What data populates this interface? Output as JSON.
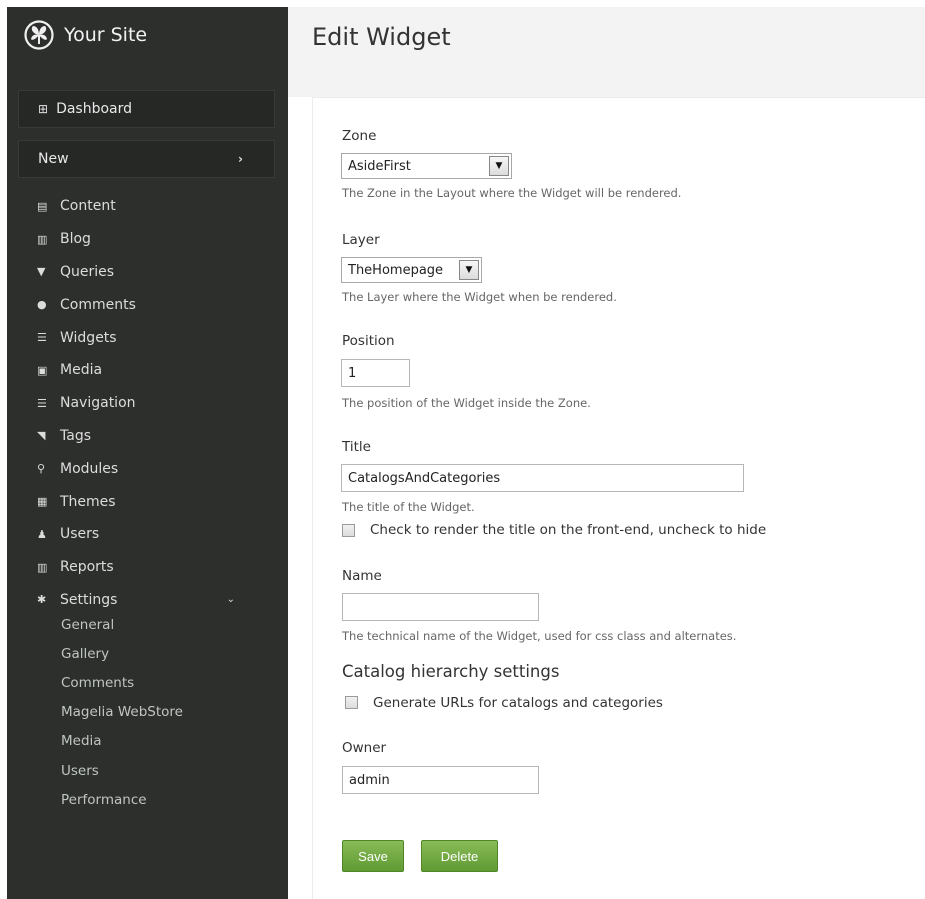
{
  "brand": {
    "name": "Your Site",
    "logo_icon": "orchard-logo-icon"
  },
  "sidebar": {
    "dashboard": {
      "label": "Dashboard",
      "icon": "dashboard-icon"
    },
    "new": {
      "label": "New",
      "icon": "chevron-right-icon"
    },
    "items": [
      {
        "label": "Content",
        "icon": "content-icon"
      },
      {
        "label": "Blog",
        "icon": "blog-icon"
      },
      {
        "label": "Queries",
        "icon": "filter-icon"
      },
      {
        "label": "Comments",
        "icon": "comment-icon"
      },
      {
        "label": "Widgets",
        "icon": "widgets-icon"
      },
      {
        "label": "Media",
        "icon": "media-icon"
      },
      {
        "label": "Navigation",
        "icon": "navigation-icon"
      },
      {
        "label": "Tags",
        "icon": "tag-icon"
      },
      {
        "label": "Modules",
        "icon": "modules-icon"
      },
      {
        "label": "Themes",
        "icon": "themes-icon"
      },
      {
        "label": "Users",
        "icon": "user-icon"
      },
      {
        "label": "Reports",
        "icon": "reports-icon"
      },
      {
        "label": "Settings",
        "icon": "gear-icon"
      }
    ],
    "settings_sub": [
      "General",
      "Gallery",
      "Comments",
      "Magelia WebStore",
      "Media",
      "Users",
      "Performance"
    ]
  },
  "page": {
    "title": "Edit Widget"
  },
  "form": {
    "zone": {
      "label": "Zone",
      "value": "AsideFirst",
      "hint": "The Zone in the Layout where the Widget will be rendered."
    },
    "layer": {
      "label": "Layer",
      "value": "TheHomepage",
      "hint": "The Layer where the Widget when be rendered."
    },
    "position": {
      "label": "Position",
      "value": "1",
      "hint": "The position of the Widget inside the Zone."
    },
    "title": {
      "label": "Title",
      "value": "CatalogsAndCategories",
      "hint": "The title of the Widget.",
      "render_checkbox_label": "Check to render the title on the front-end, uncheck to hide"
    },
    "name": {
      "label": "Name",
      "value": "",
      "hint": "The technical name of the Widget, used for css class and alternates."
    },
    "catalog": {
      "section_title": "Catalog hierarchy settings",
      "checkbox_label": "Generate URLs for catalogs and categories"
    },
    "owner": {
      "label": "Owner",
      "value": "admin"
    },
    "buttons": {
      "save": "Save",
      "delete": "Delete"
    }
  },
  "colors": {
    "sidebar_bg": "#2d2f2d",
    "button_green": "#6fa83f",
    "header_bg": "#f3f3f3"
  }
}
